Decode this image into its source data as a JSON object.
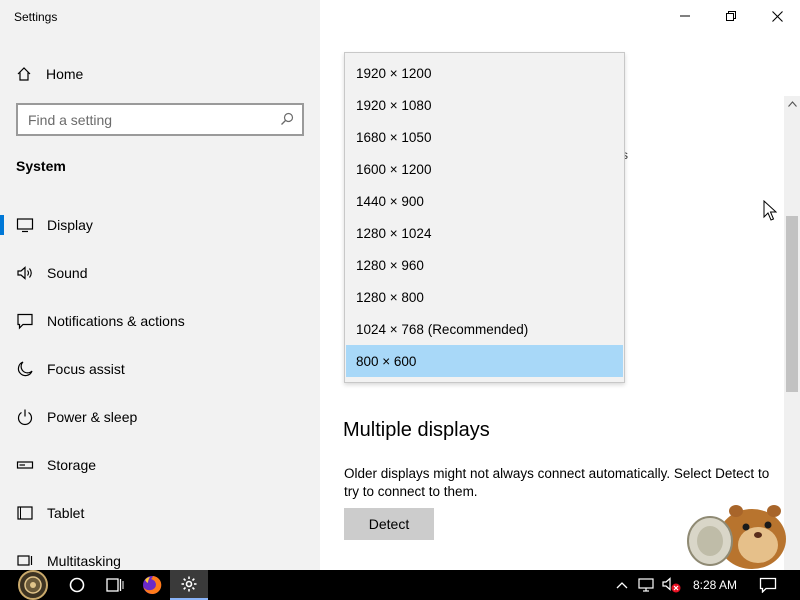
{
  "window": {
    "title": "Settings"
  },
  "sidebar": {
    "home_label": "Home",
    "search_placeholder": "Find a setting",
    "section_title": "System",
    "items": [
      {
        "label": "Display",
        "icon": "monitor-icon",
        "active": true
      },
      {
        "label": "Sound",
        "icon": "speaker-icon"
      },
      {
        "label": "Notifications & actions",
        "icon": "message-icon"
      },
      {
        "label": "Focus assist",
        "icon": "moon-icon"
      },
      {
        "label": "Power & sleep",
        "icon": "power-icon"
      },
      {
        "label": "Storage",
        "icon": "storage-icon"
      },
      {
        "label": "Tablet",
        "icon": "tablet-icon"
      },
      {
        "label": "Multitasking",
        "icon": "multitasking-icon"
      }
    ]
  },
  "main": {
    "behind_text": "s",
    "multiple_displays_title": "Multiple displays",
    "multiple_displays_desc": "Older displays might not always connect automatically. Select Detect to try to connect to them.",
    "detect_label": "Detect"
  },
  "resolution_dropdown": {
    "options": [
      "1920 × 1200",
      "1920 × 1080",
      "1680 × 1050",
      "1600 × 1200",
      "1440 × 900",
      "1280 × 1024",
      "1280 × 960",
      "1280 × 800",
      "1024 × 768 (Recommended)",
      "800 × 600"
    ],
    "selected": "800 × 600"
  },
  "taskbar": {
    "time": "8:28 AM"
  },
  "colors": {
    "accent": "#0078d7",
    "selected_item": "#a8d8f8",
    "sidebar_bg": "#f2f2f2",
    "taskbar_bg": "#000000"
  }
}
